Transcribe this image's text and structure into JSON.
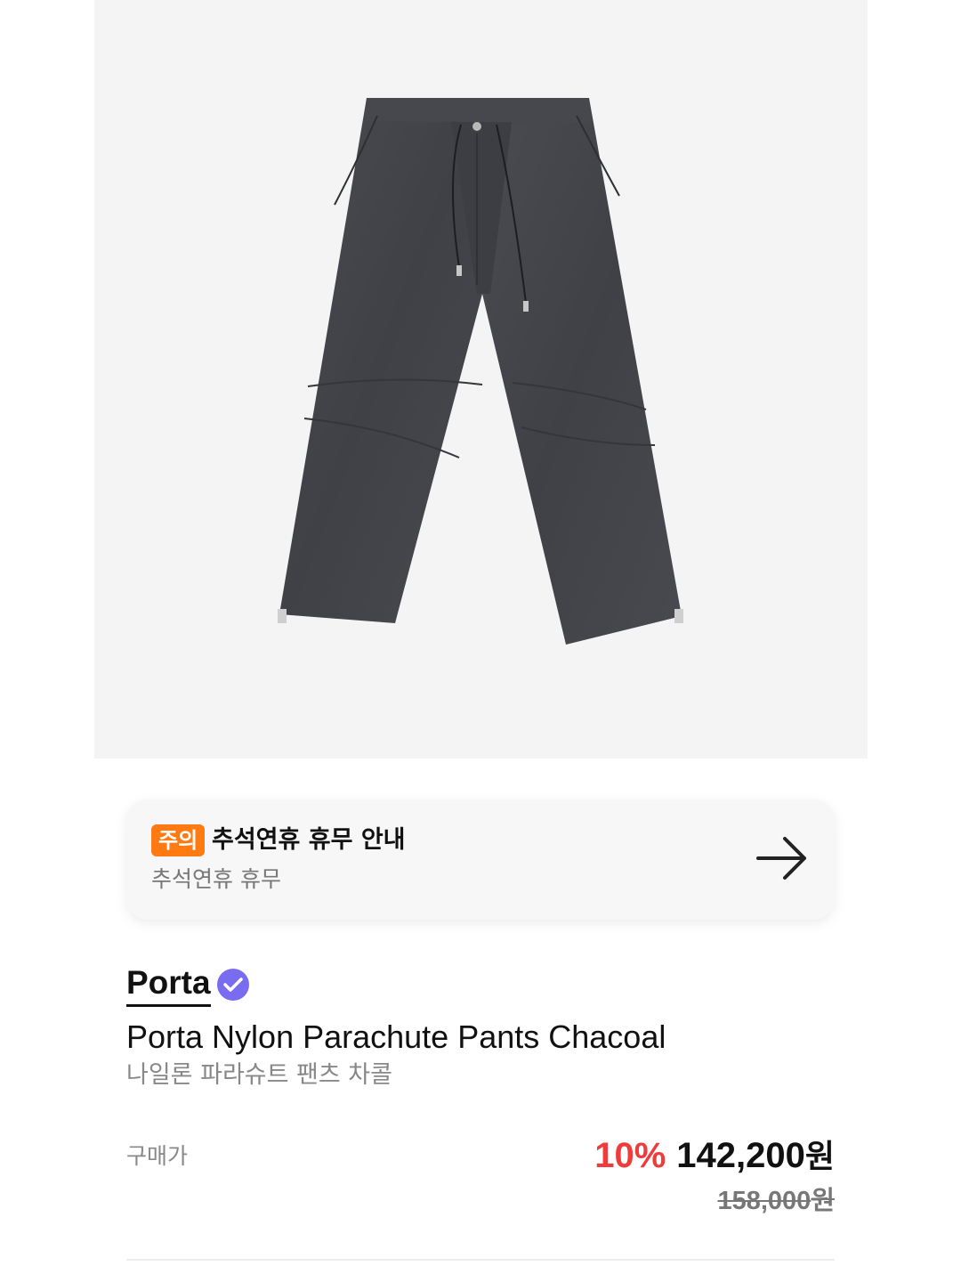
{
  "hero": {
    "image_icon": "pants-product-icon"
  },
  "notice": {
    "badge": "주의",
    "title": "추석연휴 휴무 안내",
    "subtitle": "추석연휴 휴무",
    "arrow_icon": "arrow-right-icon",
    "badge_color": "#ff7a12"
  },
  "brand": {
    "name": "Porta",
    "verified_icon": "verified-check-icon",
    "verified_color": "#7a6cf0"
  },
  "product": {
    "name": "Porta Nylon Parachute Pants Chacoal",
    "name_ko": "나일론 파라슈트 팬츠 차콜"
  },
  "price": {
    "label": "구매가",
    "discount": "10%",
    "amount": "142,200",
    "currency": "원",
    "original_amount": "158,000",
    "original_currency": "원",
    "discount_color": "#ef3b3b"
  }
}
